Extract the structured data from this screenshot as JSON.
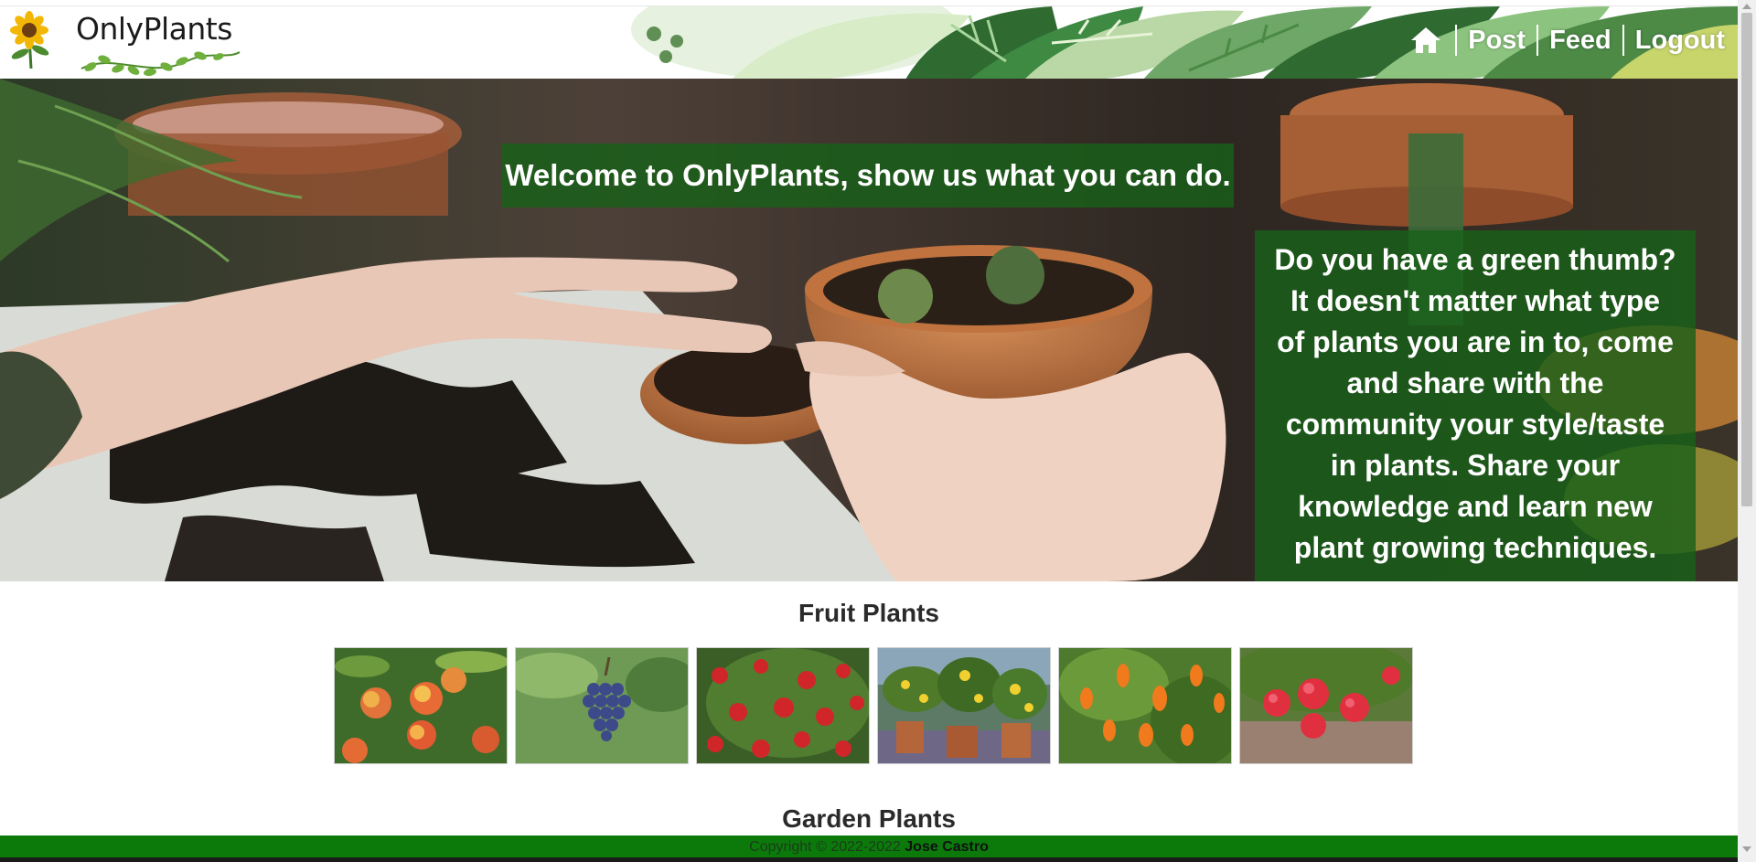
{
  "header": {
    "brand": "OnlyPlants",
    "logo_icon": "sunflower-icon",
    "nav": {
      "home_icon": "home-icon",
      "post_label": "Post",
      "feed_label": "Feed",
      "logout_label": "Logout"
    }
  },
  "hero": {
    "welcome": "Welcome to OnlyPlants, show us what you can do.",
    "intro_lines": [
      "Do you have a green thumb?",
      "It doesn't matter what type",
      "of plants you are in to, come",
      "and share with the",
      "community your style/taste",
      "in plants. Share your",
      "knowledge and learn new",
      "plant growing techniques."
    ]
  },
  "sections": {
    "fruit_title": "Fruit Plants",
    "garden_title": "Garden Plants"
  },
  "footer": {
    "copyright": "Copyright © 2022-2022",
    "author": "Jose Castro"
  },
  "colors": {
    "brand_green": "#0b7a0b",
    "overlay_green": "#186018",
    "leaf_light": "#cfe8c4",
    "leaf_dark": "#3f7a3a"
  }
}
